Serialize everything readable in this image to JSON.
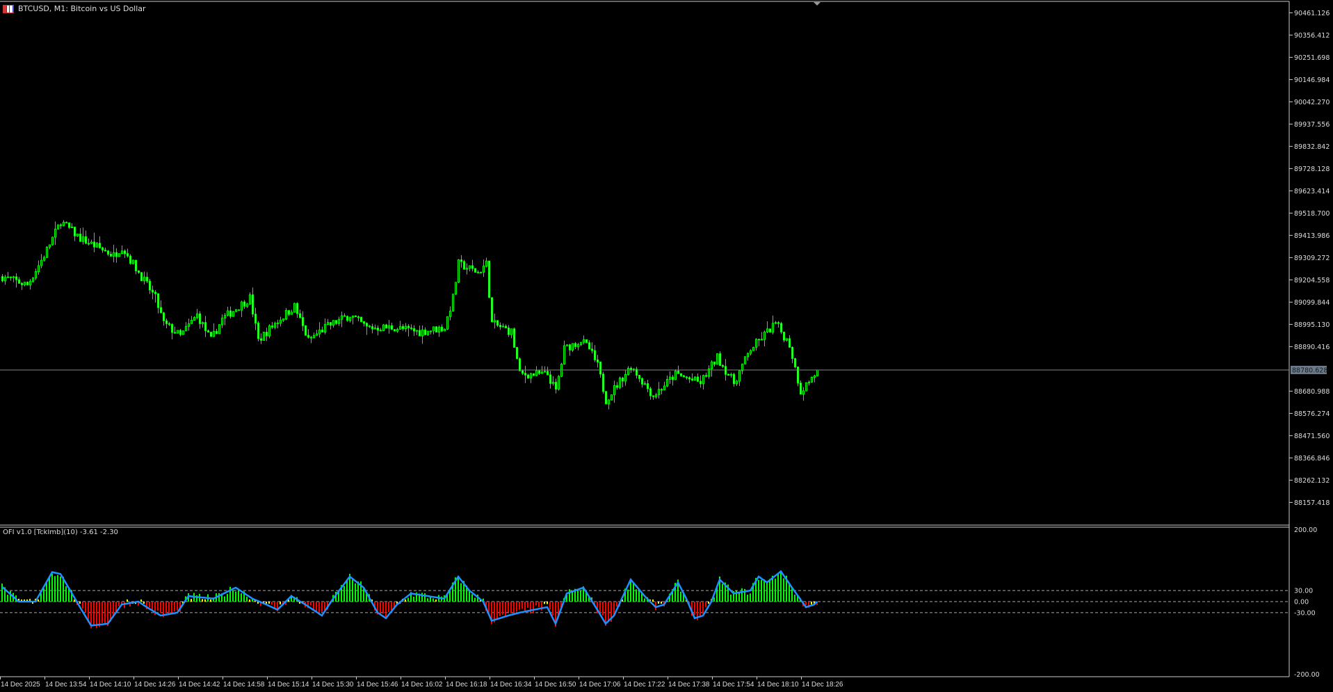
{
  "window": {
    "symbol_title": "BTCUSD, M1:  Bitcoin vs US Dollar"
  },
  "price_axis": {
    "labels": [
      "90461.126",
      "90356.412",
      "90251.698",
      "90146.984",
      "90042.270",
      "89937.556",
      "89832.842",
      "89728.128",
      "89623.414",
      "89518.700",
      "89413.986",
      "89309.272",
      "89204.558",
      "89099.844",
      "88995.130",
      "88890.416",
      "88680.988",
      "88576.274",
      "88471.560",
      "88366.846",
      "88262.132",
      "88157.418"
    ],
    "top": 90461.126,
    "step": 104.714,
    "current_price": "88780.628",
    "current_value": 88780.628
  },
  "price_series": {
    "keypoints": [
      [
        0,
        89220
      ],
      [
        9,
        89180
      ],
      [
        15,
        89320
      ],
      [
        21,
        89480
      ],
      [
        28,
        89400
      ],
      [
        34,
        89360
      ],
      [
        40,
        89320
      ],
      [
        43,
        89360
      ],
      [
        49,
        89240
      ],
      [
        55,
        89120
      ],
      [
        58,
        89000
      ],
      [
        64,
        88940
      ],
      [
        70,
        89040
      ],
      [
        75,
        88920
      ],
      [
        79,
        89020
      ],
      [
        89,
        89120
      ],
      [
        92,
        88920
      ],
      [
        98,
        89000
      ],
      [
        105,
        89080
      ],
      [
        110,
        88920
      ],
      [
        116,
        88980
      ],
      [
        125,
        89040
      ],
      [
        131,
        88980
      ],
      [
        141,
        88980
      ],
      [
        150,
        88960
      ],
      [
        159,
        88980
      ],
      [
        162,
        89120
      ],
      [
        164,
        89280
      ],
      [
        171,
        89240
      ],
      [
        174,
        89280
      ],
      [
        176,
        89000
      ],
      [
        183,
        88960
      ],
      [
        186,
        88760
      ],
      [
        196,
        88760
      ],
      [
        199,
        88680
      ],
      [
        202,
        88880
      ],
      [
        208,
        88920
      ],
      [
        211,
        88880
      ],
      [
        214,
        88800
      ],
      [
        217,
        88640
      ],
      [
        226,
        88800
      ],
      [
        234,
        88660
      ],
      [
        242,
        88760
      ],
      [
        251,
        88720
      ],
      [
        257,
        88840
      ],
      [
        263,
        88720
      ],
      [
        269,
        88880
      ],
      [
        278,
        89000
      ],
      [
        283,
        88900
      ],
      [
        287,
        88680
      ],
      [
        292,
        88760
      ],
      [
        293,
        88780
      ]
    ],
    "bull_color": "#00ff00",
    "bear_color": "#00ff00"
  },
  "indicator": {
    "label": "OFI v1.0 [TckImb](10) -3.61 -2.30",
    "axis_labels": [
      "200.00",
      "30.00",
      "0.00",
      "-30.00",
      "-200.00"
    ],
    "levels": [
      200,
      30,
      0,
      -30,
      -200
    ],
    "keypoints": [
      [
        0,
        40
      ],
      [
        6,
        0
      ],
      [
        12,
        0
      ],
      [
        18,
        80
      ],
      [
        21,
        75
      ],
      [
        28,
        -15
      ],
      [
        32,
        -65
      ],
      [
        38,
        -60
      ],
      [
        43,
        -8
      ],
      [
        49,
        0
      ],
      [
        52,
        -15
      ],
      [
        57,
        -38
      ],
      [
        63,
        -30
      ],
      [
        67,
        15
      ],
      [
        76,
        8
      ],
      [
        84,
        38
      ],
      [
        90,
        8
      ],
      [
        95,
        -8
      ],
      [
        99,
        -22
      ],
      [
        104,
        15
      ],
      [
        109,
        -8
      ],
      [
        115,
        -38
      ],
      [
        119,
        8
      ],
      [
        125,
        68
      ],
      [
        130,
        38
      ],
      [
        135,
        -30
      ],
      [
        138,
        -45
      ],
      [
        142,
        -8
      ],
      [
        147,
        22
      ],
      [
        153,
        15
      ],
      [
        159,
        8
      ],
      [
        164,
        68
      ],
      [
        168,
        30
      ],
      [
        173,
        0
      ],
      [
        176,
        -52
      ],
      [
        182,
        -38
      ],
      [
        186,
        -30
      ],
      [
        196,
        -15
      ],
      [
        199,
        -60
      ],
      [
        203,
        22
      ],
      [
        209,
        38
      ],
      [
        214,
        -22
      ],
      [
        217,
        -60
      ],
      [
        220,
        -38
      ],
      [
        226,
        60
      ],
      [
        231,
        15
      ],
      [
        235,
        -15
      ],
      [
        238,
        -8
      ],
      [
        243,
        52
      ],
      [
        246,
        8
      ],
      [
        249,
        -45
      ],
      [
        252,
        -38
      ],
      [
        255,
        0
      ],
      [
        258,
        60
      ],
      [
        263,
        22
      ],
      [
        269,
        30
      ],
      [
        272,
        68
      ],
      [
        275,
        52
      ],
      [
        280,
        82
      ],
      [
        284,
        38
      ],
      [
        289,
        -15
      ],
      [
        292,
        -8
      ],
      [
        293,
        0
      ]
    ],
    "colors": {
      "positive": "#00ff00",
      "negative": "#ff0000",
      "neutral": "#ffff00",
      "line": "#1e90ff"
    }
  },
  "time_axis": {
    "labels": [
      "14 Dec 2025",
      "14 Dec 13:54",
      "14 Dec 14:10",
      "14 Dec 14:26",
      "14 Dec 14:42",
      "14 Dec 14:58",
      "14 Dec 15:14",
      "14 Dec 15:30",
      "14 Dec 15:46",
      "14 Dec 16:02",
      "14 Dec 16:18",
      "14 Dec 16:34",
      "14 Dec 16:50",
      "14 Dec 17:06",
      "14 Dec 17:22",
      "14 Dec 17:38",
      "14 Dec 17:54",
      "14 Dec 18:10",
      "14 Dec 18:26"
    ]
  }
}
